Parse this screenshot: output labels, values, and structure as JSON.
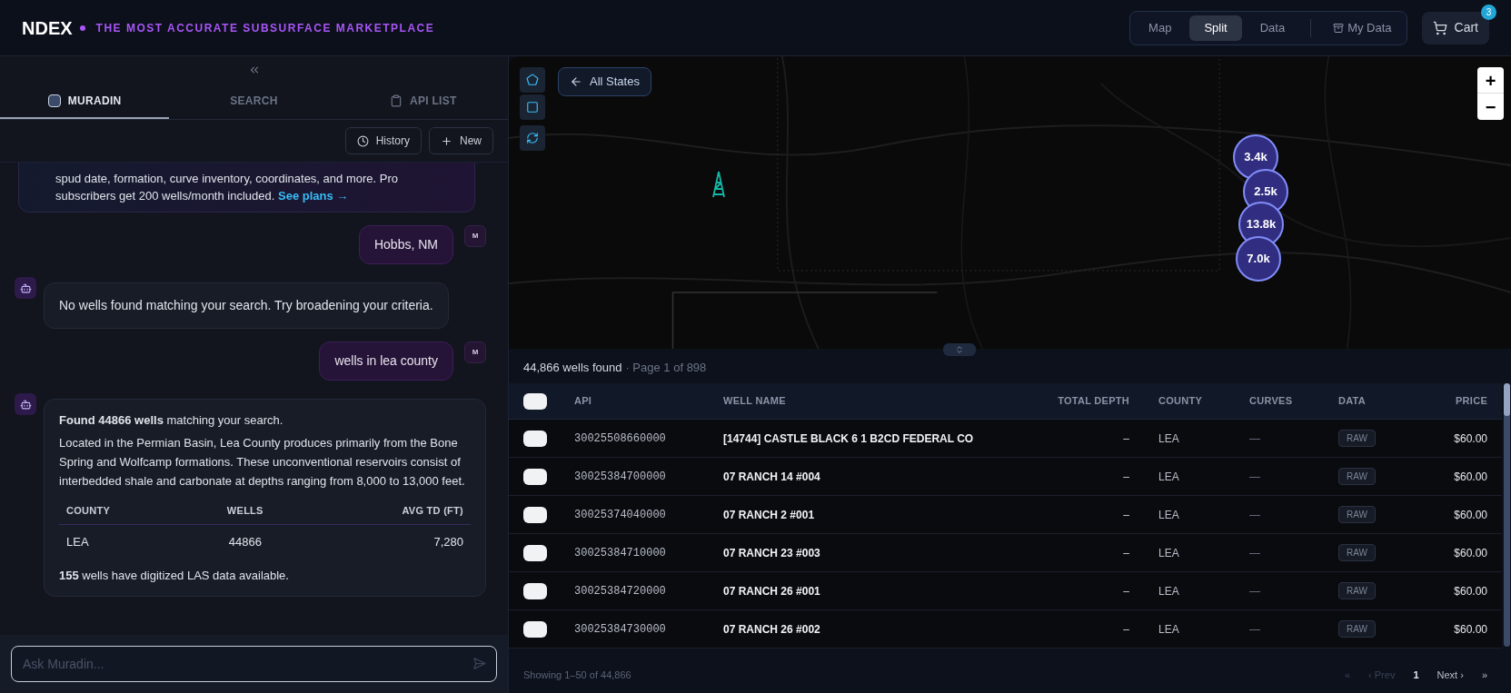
{
  "header": {
    "logo": "NDEX",
    "tagline": "THE MOST ACCURATE SUBSURFACE MARKETPLACE",
    "views": [
      {
        "label": "Map",
        "selected": false
      },
      {
        "label": "Split",
        "selected": true
      },
      {
        "label": "Data",
        "selected": false
      }
    ],
    "my_data": "My Data",
    "cart": {
      "label": "Cart",
      "badge": "3"
    }
  },
  "assistant": {
    "tabs": [
      {
        "label": "MURADIN",
        "kind": "avatar",
        "selected": true
      },
      {
        "label": "SEARCH",
        "kind": "plain",
        "selected": false
      },
      {
        "label": "API LIST",
        "kind": "clipboard",
        "selected": false
      }
    ],
    "actions": [
      {
        "label": "History",
        "kind": "history"
      },
      {
        "label": "New",
        "kind": "new"
      }
    ],
    "messages": [
      {
        "kind": "promo",
        "text": "spud date, formation, curve inventory, coordinates, and more. Pro subscribers get 200 wells/month included.",
        "link": "See plans →"
      },
      {
        "kind": "user",
        "text": "Hobbs, NM",
        "avatar": "M"
      },
      {
        "kind": "text",
        "text": "No wells found matching your search. Try broadening your criteria."
      },
      {
        "kind": "user",
        "text": "wells in lea county",
        "avatar": "M"
      },
      {
        "kind": "result",
        "paragraphs": [
          "**Found 44866 wells** matching your search.",
          "Located in the Permian Basin, Lea County produces primarily from the Bone Spring and Wolfcamp formations. These unconventional reservoirs consist of interbedded shale and carbonate at depths ranging from 8,000 to 13,000 feet."
        ],
        "table": {
          "columns": [
            "COUNTY",
            "WELLS",
            "AVG TD (FT)"
          ],
          "rows": [
            [
              "LEA",
              "44866",
              "7,280"
            ]
          ]
        },
        "footnote": "**155** wells have digitized LAS data available."
      }
    ],
    "input": {
      "placeholder": "Ask Muradin..."
    }
  },
  "map": {
    "back_button": "All States",
    "clusters": [
      {
        "label": "3.4k"
      },
      {
        "label": "2.5k"
      },
      {
        "label": "13.8k"
      },
      {
        "label": "7.0k"
      }
    ],
    "zoom_in": "+",
    "zoom_out": "−"
  },
  "results": {
    "summary": "44,866 wells found",
    "page": "· Page 1 of 898",
    "select_all": {
      "checked": false
    },
    "columns": [
      "API",
      "WELL NAME",
      "TOTAL DEPTH",
      "COUNTY",
      "CURVES",
      "DATA",
      "PRICE"
    ],
    "rows": [
      {
        "checked": false,
        "api": "30025508660000",
        "name": "[14744] CASTLE BLACK 6 1 B2CD FEDERAL CO",
        "depth": "–",
        "county": "LEA",
        "curves": "—",
        "data": "RAW",
        "price": "$60.00"
      },
      {
        "checked": false,
        "api": "30025384700000",
        "name": "07 RANCH 14 #004",
        "depth": "–",
        "county": "LEA",
        "curves": "—",
        "data": "RAW",
        "price": "$60.00"
      },
      {
        "checked": false,
        "api": "30025374040000",
        "name": "07 RANCH 2 #001",
        "depth": "–",
        "county": "LEA",
        "curves": "—",
        "data": "RAW",
        "price": "$60.00"
      },
      {
        "checked": false,
        "api": "30025384710000",
        "name": "07 RANCH 23 #003",
        "depth": "–",
        "county": "LEA",
        "curves": "—",
        "data": "RAW",
        "price": "$60.00"
      },
      {
        "checked": false,
        "api": "30025384720000",
        "name": "07 RANCH 26 #001",
        "depth": "–",
        "county": "LEA",
        "curves": "—",
        "data": "RAW",
        "price": "$60.00"
      },
      {
        "checked": false,
        "api": "30025384730000",
        "name": "07 RANCH 26 #002",
        "depth": "–",
        "county": "LEA",
        "curves": "—",
        "data": "RAW",
        "price": "$60.00"
      }
    ],
    "showing": "Showing 1–50 of 44,866",
    "pagination": [
      {
        "label": "«",
        "kind": "first",
        "disabled": true
      },
      {
        "label": "‹ Prev",
        "kind": "prev",
        "disabled": true
      },
      {
        "label": "1",
        "kind": "page",
        "disabled": false
      },
      {
        "label": "Next ›",
        "kind": "next",
        "disabled": false
      },
      {
        "label": "»",
        "kind": "last",
        "disabled": false
      }
    ]
  }
}
